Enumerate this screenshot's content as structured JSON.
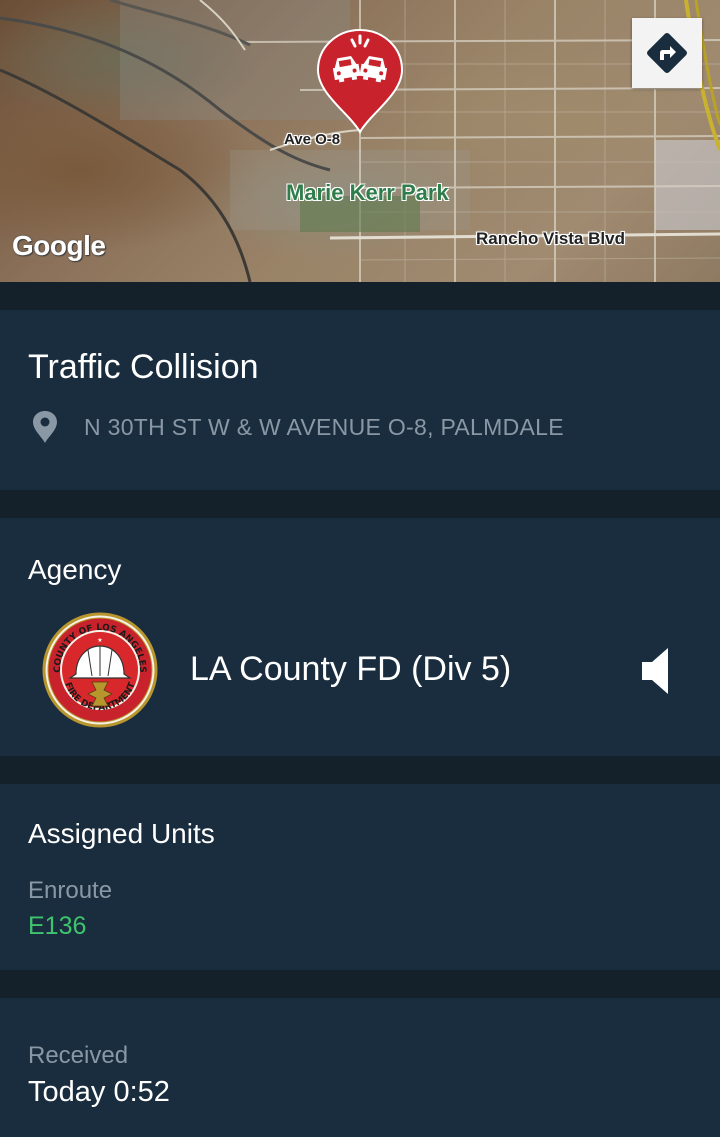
{
  "map": {
    "labels": {
      "ave": "Ave O-8",
      "park": "Marie Kerr Park",
      "road": "Rancho Vista Blvd"
    },
    "attribution": "Google",
    "marker_icon": "traffic-collision-pin-icon",
    "directions_icon": "directions-icon"
  },
  "incident": {
    "title": "Traffic Collision",
    "address_icon": "location-pin-icon",
    "address": "N 30TH ST W & W AVENUE O-8, PALMDALE"
  },
  "agency": {
    "heading": "Agency",
    "logo_icon": "la-county-fire-department-seal",
    "logo_text": "COUNTY OF LOS ANGELES FIRE DEPARTMENT",
    "name": "LA County FD (Div 5)",
    "audio_icon": "speaker-icon"
  },
  "units": {
    "heading": "Assigned Units",
    "status": "Enroute",
    "unit": "E136"
  },
  "received": {
    "label": "Received",
    "value": "Today 0:52"
  },
  "colors": {
    "background": "#14212b",
    "card": "#1a2d3e",
    "secondary_text": "#8a98a6",
    "unit_green": "#3ec46d",
    "marker_red": "#c8232c"
  }
}
